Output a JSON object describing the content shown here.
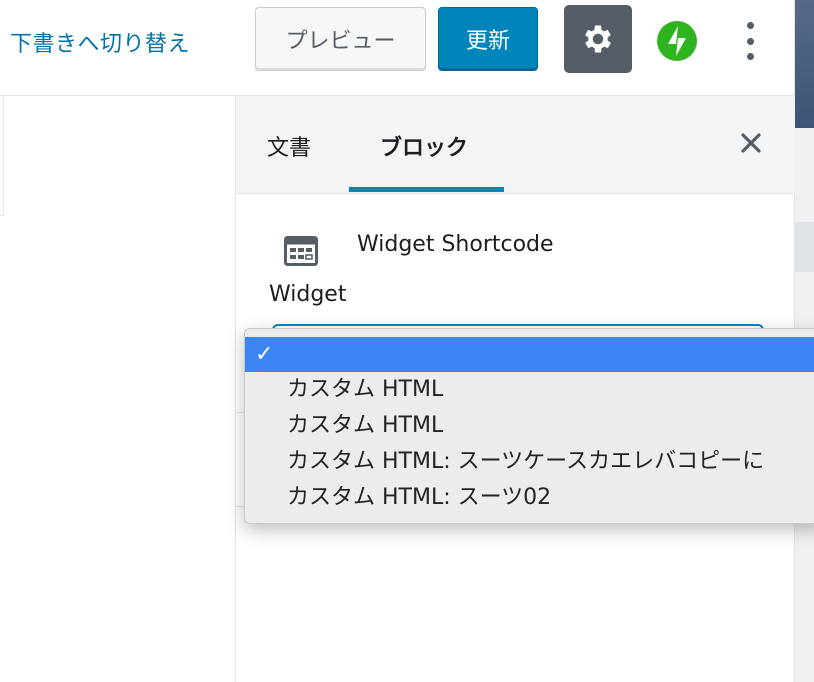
{
  "header": {
    "switch_to_draft": "下書きへ切り替え",
    "preview_label": "プレビュー",
    "update_label": "更新",
    "settings_icon": "gear-icon",
    "jetpack_icon": "jetpack-bolt-icon",
    "more_icon": "vertical-ellipsis-icon",
    "accent_color": "#0085ba"
  },
  "sidebar": {
    "tabs": [
      {
        "label": "文書",
        "active": false
      },
      {
        "label": "ブロック",
        "active": true
      }
    ],
    "close_icon": "close-icon",
    "block": {
      "icon": "widget-table-icon",
      "title": "Widget Shortcode",
      "field_label": "Widget"
    }
  },
  "dropdown": {
    "selected_mark": "✓",
    "options": [
      {
        "label": "",
        "selected": true
      },
      {
        "label": "カスタム HTML",
        "selected": false
      },
      {
        "label": "カスタム HTML",
        "selected": false
      },
      {
        "label": "カスタム HTML: スーツケースカエレバコピーに",
        "selected": false
      },
      {
        "label": "カスタム HTML: スーツ02",
        "selected": false
      }
    ],
    "highlight_color": "#3d85f5"
  }
}
